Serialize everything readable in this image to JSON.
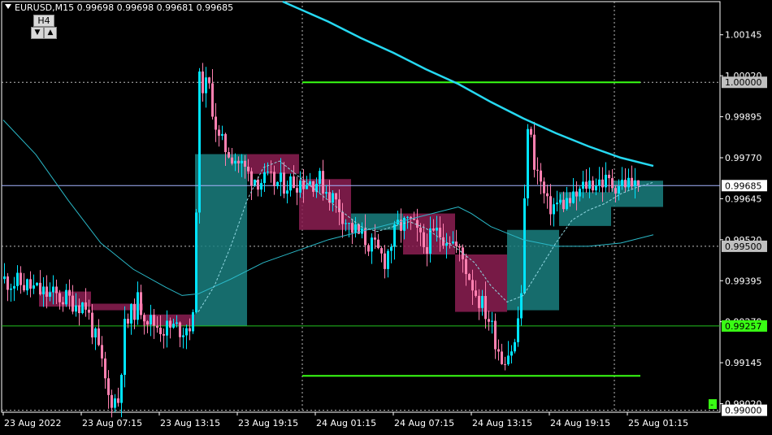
{
  "header": {
    "symbol_line": "EURUSD,M15  0.99698 0.99698 0.99681 0.99685",
    "timeframe_label": "H4",
    "tf_down": "▼",
    "tf_up": "▲"
  },
  "colors": {
    "background": "#000000",
    "bull_candle": "#00e5ff",
    "bear_candle": "#ff80b0",
    "bull_htf_box": "#1a7f7f",
    "bear_htf_box": "#8c1e52",
    "ma_slow": "#26d9f2",
    "ma_fast": "#2ab8c7",
    "ma_dash": "#8fd6e0",
    "level_line": "#39ff14",
    "current_price": "#a6b5ff",
    "grid": "#bbbbbb"
  },
  "chart_data": {
    "type": "candlestick",
    "symbol": "EURUSD",
    "timeframe": "M15",
    "ohlc_current": {
      "open": 0.99698,
      "high": 0.99698,
      "low": 0.99681,
      "close": 0.99685
    },
    "y_axis_ticks": [
      "1.00145",
      "1.00020",
      "0.99895",
      "0.99770",
      "0.99645",
      "0.99520",
      "0.99395",
      "0.99270",
      "0.99145",
      "0.99020"
    ],
    "y_tick_values": [
      1.00145,
      1.0002,
      0.99895,
      0.9977,
      0.99645,
      0.9952,
      0.99395,
      0.9927,
      0.99145,
      0.9902
    ],
    "ylim": [
      0.98994,
      1.00246
    ],
    "x_axis_ticks": [
      "23 Aug 2022",
      "23 Aug 07:15",
      "23 Aug 13:15",
      "23 Aug 19:15",
      "24 Aug 01:15",
      "24 Aug 07:15",
      "24 Aug 13:15",
      "24 Aug 19:15",
      "25 Aug 01:15"
    ],
    "x_tick_positions": [
      0,
      24,
      48,
      72,
      96,
      120,
      144,
      168,
      192
    ],
    "xlim": [
      0,
      236
    ],
    "price_labels": [
      {
        "text": "1.00000",
        "value": 1.0,
        "style": "gray"
      },
      {
        "text": "0.99685",
        "value": 0.99685,
        "style": "white"
      },
      {
        "text": "0.99500",
        "value": 0.995,
        "style": "gray"
      },
      {
        "text": "0.99257",
        "value": 0.99257,
        "style": "green"
      },
      {
        "text": "0.99000",
        "value": 0.99,
        "style": "white"
      }
    ],
    "bottom_marker": "-",
    "dotted_levels": [
      1.0,
      0.995,
      0.99
    ],
    "dotted_times": [
      92,
      188
    ],
    "green_segments": [
      {
        "value": 1.0,
        "from": 92,
        "to": 196
      },
      {
        "value": 0.99105,
        "from": 92,
        "to": 196
      }
    ],
    "green_full_line": 0.99257,
    "current_price": 0.99685,
    "htf_boxes": [
      {
        "from": 11,
        "to": 27,
        "open": 0.99362,
        "close": 0.99316
      },
      {
        "from": 27,
        "to": 43,
        "open": 0.99325,
        "close": 0.99305
      },
      {
        "from": 43,
        "to": 59,
        "open": 0.99292,
        "close": 0.99257
      },
      {
        "from": 59,
        "to": 75,
        "open": 0.99257,
        "close": 0.99781
      },
      {
        "from": 75,
        "to": 91,
        "open": 0.99781,
        "close": 0.99721
      },
      {
        "from": 91,
        "to": 107,
        "open": 0.99705,
        "close": 0.9955
      },
      {
        "from": 107,
        "to": 123,
        "open": 0.9955,
        "close": 0.996
      },
      {
        "from": 123,
        "to": 139,
        "open": 0.996,
        "close": 0.99475
      },
      {
        "from": 139,
        "to": 155,
        "open": 0.99475,
        "close": 0.993
      },
      {
        "from": 155,
        "to": 171,
        "open": 0.99305,
        "close": 0.9955
      },
      {
        "from": 171,
        "to": 187,
        "open": 0.99562,
        "close": 0.99665
      },
      {
        "from": 187,
        "to": 203,
        "open": 0.9962,
        "close": 0.997
      }
    ],
    "ma_slow": {
      "x": [
        86,
        100,
        110,
        120,
        130,
        140,
        150,
        160,
        170,
        180,
        190,
        200
      ],
      "y": [
        1.00246,
        1.00185,
        1.00135,
        1.0009,
        1.0004,
        0.99995,
        0.9994,
        0.9989,
        0.99845,
        0.99805,
        0.9977,
        0.99745
      ]
    },
    "ma_fast": {
      "x": [
        0,
        10,
        20,
        30,
        40,
        50,
        55,
        60,
        70,
        80,
        90,
        100,
        110,
        120,
        130,
        140,
        144,
        150,
        160,
        170,
        180,
        190,
        200
      ],
      "y": [
        0.99885,
        0.9978,
        0.9964,
        0.9951,
        0.9943,
        0.99375,
        0.9935,
        0.99355,
        0.994,
        0.9945,
        0.99485,
        0.9952,
        0.99545,
        0.9957,
        0.99595,
        0.9962,
        0.996,
        0.9956,
        0.9952,
        0.995,
        0.995,
        0.9951,
        0.99535
      ]
    },
    "ma_dash": {
      "x": [
        60,
        65,
        70,
        75,
        80,
        85,
        90,
        95,
        100,
        105,
        110,
        115,
        120,
        125,
        130,
        135,
        140,
        145,
        150,
        155,
        160,
        165,
        170,
        175,
        180,
        185,
        190,
        195,
        200
      ],
      "y": [
        0.993,
        0.9938,
        0.995,
        0.9964,
        0.9974,
        0.9976,
        0.9972,
        0.9968,
        0.9964,
        0.996,
        0.9956,
        0.99545,
        0.9956,
        0.99575,
        0.99555,
        0.9952,
        0.9949,
        0.9945,
        0.9938,
        0.9933,
        0.9935,
        0.9943,
        0.9951,
        0.9958,
        0.9961,
        0.9963,
        0.9966,
        0.9968,
        0.99695
      ]
    }
  }
}
